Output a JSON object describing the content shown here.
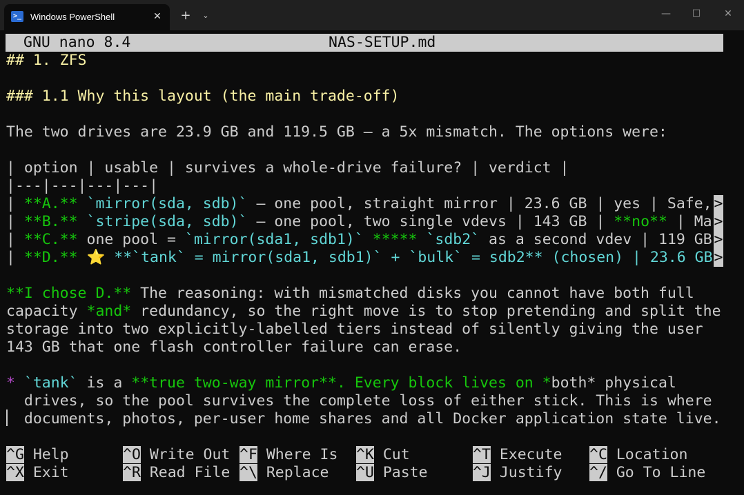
{
  "window": {
    "tab_title": "Windows PowerShell",
    "tab_icon": "powershell-icon",
    "close_tab_glyph": "✕",
    "new_tab_glyph": "+",
    "dropdown_glyph": "⌄",
    "minimize_glyph": "—",
    "maximize_glyph": "☐",
    "close_glyph": "✕"
  },
  "editor": {
    "name": "GNU nano 8.4",
    "filename": "NAS-SETUP.md"
  },
  "lines": {
    "h2": "## 1. ZFS",
    "h3": "### 1.1 Why this layout (the main trade-off)",
    "intro": "The two drives are 23.9 GB and 119.5 GB — a 5x mismatch. The options were:",
    "table_header": "| option | usable | survives a whole-drive failure? | verdict |",
    "table_sep": "|---|---|---|---|",
    "rowA_1": "| ",
    "rowA_2": "**A.**",
    "rowA_3": " ",
    "rowA_4": "`mirror(sda, sdb)`",
    "rowA_5": " — one pool, straight mirror | 23.6 GB | yes | Safe,",
    "rowB_1": "| ",
    "rowB_2": "**B.**",
    "rowB_3": " ",
    "rowB_4": "`stripe(sda, sdb)`",
    "rowB_5": " — one pool, two single vdevs | 143 GB | ",
    "rowB_6": "**no**",
    "rowB_7": " | Ma",
    "rowC_1": "| ",
    "rowC_2": "**C.**",
    "rowC_3": " one pool = ",
    "rowC_4": "`mirror(sda1, sdb1)`",
    "rowC_5": " ",
    "rowC_6": "*****",
    "rowC_7": " ",
    "rowC_8": "`sdb2`",
    "rowC_9": " as a second vdev | 119 GB",
    "rowD_1": "| ",
    "rowD_2": "**D.**",
    "rowD_3": " ",
    "rowD_star": "⭐",
    "rowD_4": " ",
    "rowD_5": "**`tank` = mirror(sda1, sdb1)` + `bulk` = sdb2**",
    "rowD_6": " (chosen) | 23.6 GB",
    "overflow": ">",
    "p1_bold": "**I chose D.**",
    "p1_rest": " The reasoning: with mismatched disks you cannot have both full",
    "p2_a": "capacity ",
    "p2_b": "*and*",
    "p2_c": " redundancy, so the right move is to stop pretending and split the",
    "p3": "storage into two explicitly-labelled tiers instead of silently giving the user",
    "p4": "143 GB that one flash controller failure can erase.",
    "b1_star": "*",
    "b1_a": " ",
    "b1_b": "`tank`",
    "b1_c": " is a ",
    "b1_d": "**true two-way mirror**. Every block lives on *",
    "b1_e": "both",
    "b1_f": "* physical",
    "b2": "  drives, so the pool survives the complete loss of either stick. This is where",
    "b3": "  documents, photos, per-user home shares and all Docker application state live."
  },
  "shortcuts": [
    {
      "key": "^G",
      "label": "Help"
    },
    {
      "key": "^O",
      "label": "Write Out"
    },
    {
      "key": "^F",
      "label": "Where Is"
    },
    {
      "key": "^K",
      "label": "Cut"
    },
    {
      "key": "^T",
      "label": "Execute"
    },
    {
      "key": "^C",
      "label": "Location"
    },
    {
      "key": "^X",
      "label": "Exit"
    },
    {
      "key": "^R",
      "label": "Read File"
    },
    {
      "key": "^\\",
      "label": "Replace"
    },
    {
      "key": "^U",
      "label": "Paste"
    },
    {
      "key": "^J",
      "label": "Justify"
    },
    {
      "key": "^/",
      "label": "Go To Line"
    }
  ]
}
